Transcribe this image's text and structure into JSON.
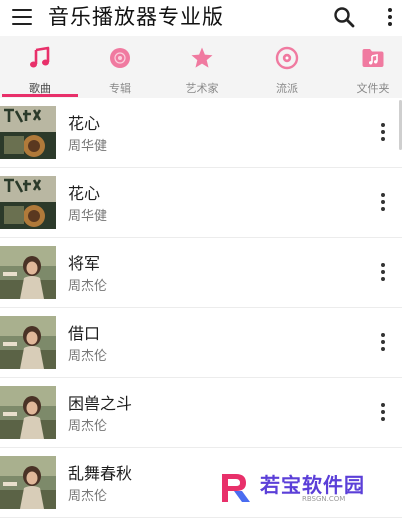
{
  "app": {
    "title": "音乐播放器专业版"
  },
  "toolbar": {
    "menu_icon": "hamburger-menu-icon",
    "search_icon": "search-icon",
    "more_icon": "more-vert-icon"
  },
  "tabs": [
    {
      "label": "歌曲",
      "icon": "music-note-icon",
      "active": true
    },
    {
      "label": "专辑",
      "icon": "disc-icon",
      "active": false
    },
    {
      "label": "艺术家",
      "icon": "star-icon",
      "active": false
    },
    {
      "label": "流派",
      "icon": "vinyl-icon",
      "active": false
    },
    {
      "label": "文件夹",
      "icon": "folder-music-icon",
      "active": false
    }
  ],
  "songs": [
    {
      "title": "花心",
      "artist": "周华健"
    },
    {
      "title": "花心",
      "artist": "周华健"
    },
    {
      "title": "将军",
      "artist": "周杰伦"
    },
    {
      "title": "借口",
      "artist": "周杰伦"
    },
    {
      "title": "困兽之斗",
      "artist": "周杰伦"
    },
    {
      "title": "乱舞春秋",
      "artist": "周杰伦"
    }
  ],
  "watermark": {
    "text": "若宝软件园",
    "url": "RBSGN.COM"
  },
  "colors": {
    "accent": "#e8306a",
    "accent_light": "#f07aa0",
    "watermark": "#5b3fd8"
  }
}
